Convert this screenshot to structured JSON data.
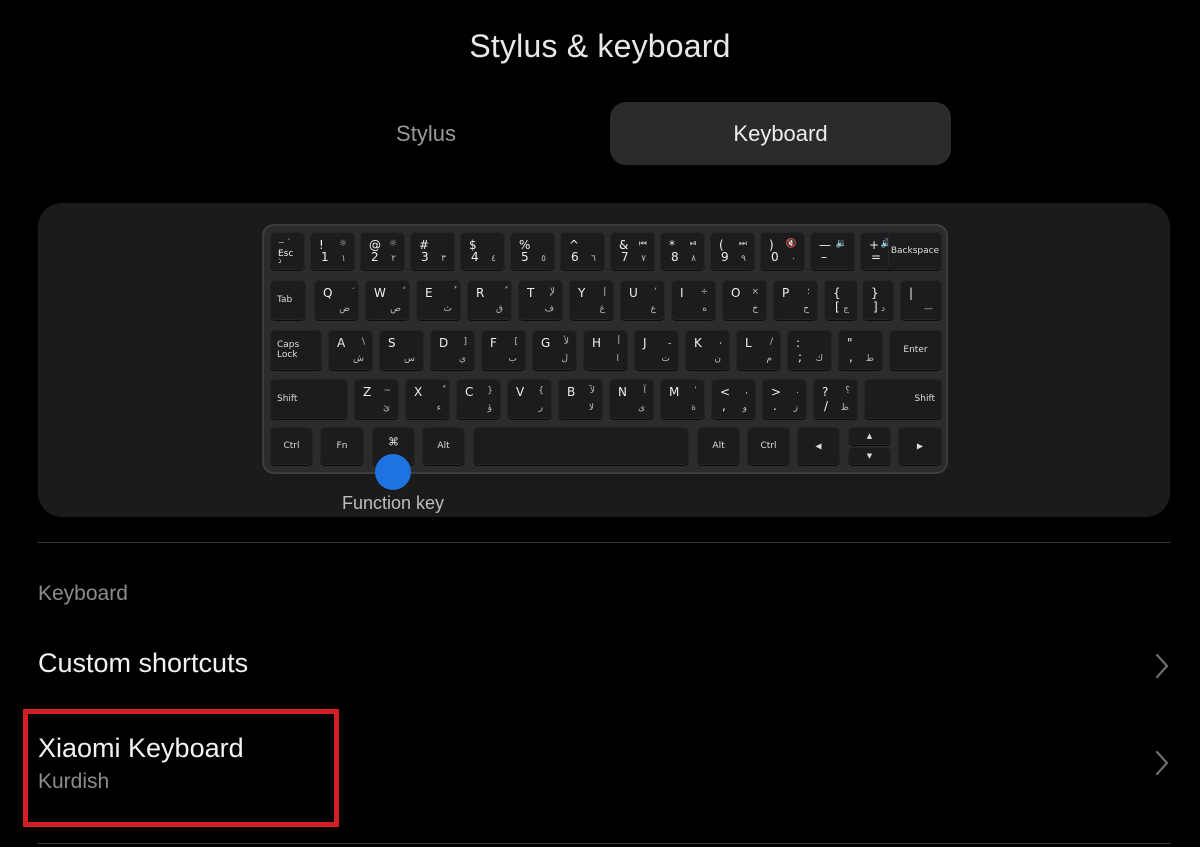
{
  "header": {
    "title": "Stylus & keyboard"
  },
  "tabs": [
    {
      "label": "Stylus",
      "selected": false
    },
    {
      "label": "Keyboard",
      "selected": true
    }
  ],
  "keyboard_diagram": {
    "function_key_label": "Function key",
    "marker_color": "#1f73e0",
    "keys": {
      "esc": {
        "top": "~ `",
        "main": "Esc",
        "bottom": "ذ"
      },
      "k1": {
        "pl": "!",
        "pr": "☼",
        "sl": "1",
        "sr": "١"
      },
      "k2": {
        "pl": "@",
        "pr": "☼",
        "sl": "2",
        "sr": "٢"
      },
      "k3": {
        "pl": "#",
        "sl": "3",
        "sr": "٣"
      },
      "k4": {
        "pl": "$",
        "sl": "4",
        "sr": "٤"
      },
      "k5": {
        "pl": "%",
        "sl": "5",
        "sr": "٥"
      },
      "k6": {
        "pl": "^",
        "sl": "6",
        "sr": "٦"
      },
      "k7": {
        "pl": "&",
        "pr": "⏮",
        "sl": "7",
        "sr": "٧"
      },
      "k8": {
        "pl": "*",
        "pr": "⏯",
        "sl": "8",
        "sr": "٨"
      },
      "k9": {
        "pl": "(",
        "pr": "⏭",
        "sl": "9",
        "sr": "٩"
      },
      "k0": {
        "pl": ")",
        "pr": "🔇",
        "sl": "0",
        "sr": "٠"
      },
      "kminus": {
        "pl": "—",
        "pr": "🔉",
        "sl": "–",
        "sr": ""
      },
      "kplus": {
        "pl": "+",
        "pr": "🔊",
        "sl": "=",
        "sr": ""
      },
      "backspace": "Backspace",
      "tab": "Tab",
      "q": {
        "pl": "Q",
        "pr": "َ",
        "sr": "ض"
      },
      "w": {
        "pl": "W",
        "pr": "ً",
        "sr": "ص"
      },
      "e": {
        "pl": "E",
        "pr": "ُ",
        "sr": "ث"
      },
      "r": {
        "pl": "R",
        "pr": "ٌ",
        "sr": "ق"
      },
      "t": {
        "pl": "T",
        "pr": "لإ",
        "sr": "ف"
      },
      "y": {
        "pl": "Y",
        "pr": "إ",
        "sr": "غ"
      },
      "u": {
        "pl": "U",
        "pr": "‘",
        "sr": "ع"
      },
      "i": {
        "pl": "I",
        "pr": "÷",
        "sr": "ه"
      },
      "o": {
        "pl": "O",
        "pr": "×",
        "sr": "خ"
      },
      "p": {
        "pl": "P",
        "pr": "؛",
        "sr": "ح"
      },
      "lbr": {
        "pl": "{",
        "pr": "<",
        "sl": "[",
        "sr": "ج"
      },
      "rbr": {
        "pl": "}",
        "pr": ">",
        "sl": "]",
        "sr": "د"
      },
      "bsl": {
        "pl": "|",
        "sr": "—"
      },
      "caps": "Caps Lock",
      "a": {
        "pl": "A",
        "pr": "\\",
        "sr": "ش"
      },
      "s": {
        "pl": "S",
        "sr": "س"
      },
      "d": {
        "pl": "D",
        "pr": "]",
        "sr": "ي"
      },
      "f": {
        "pl": "F",
        "pr": "[",
        "sr": "ب"
      },
      "g": {
        "pl": "G",
        "pr": "لأ",
        "sr": "ل"
      },
      "h": {
        "pl": "H",
        "pr": "أ",
        "sr": "ا"
      },
      "j": {
        "pl": "J",
        "pr": "ـ",
        "sr": "ت"
      },
      "k": {
        "pl": "K",
        "pr": "،",
        "sr": "ن"
      },
      "l": {
        "pl": "L",
        "pr": "/",
        "sr": "م"
      },
      "semi": {
        "pl": ":",
        "sl": ";",
        "sr": "ك"
      },
      "quote": {
        "pl": "\"",
        "sl": ",",
        "sr": "ط"
      },
      "enter": "Enter",
      "shift_l": "Shift",
      "z": {
        "pl": "Z",
        "pr": "~",
        "sr": "ئ"
      },
      "x": {
        "pl": "X",
        "pr": "ْ",
        "sr": "ء"
      },
      "c": {
        "pl": "C",
        "pr": "}",
        "sr": "ؤ"
      },
      "v": {
        "pl": "V",
        "pr": "{",
        "sr": "ر"
      },
      "b": {
        "pl": "B",
        "pr": "لآ",
        "sr": "لا"
      },
      "n": {
        "pl": "N",
        "pr": "آ",
        "sr": "ى"
      },
      "m": {
        "pl": "M",
        "pr": "’",
        "sr": "ة"
      },
      "comma": {
        "pl": "<",
        "pr": ",",
        "sl": ",",
        "sr": "و"
      },
      "period": {
        "pl": ">",
        "pr": ".",
        "sl": ".",
        "sr": "ز"
      },
      "slash": {
        "pl": "?",
        "pr": "؟",
        "sl": "/",
        "sr": "ظ"
      },
      "shift_r": "Shift",
      "ctrl_l": "Ctrl",
      "fn": "Fn",
      "func_icon": "⌘",
      "alt_l": "Alt",
      "alt_r": "Alt",
      "ctrl_r": "Ctrl",
      "left": "◀",
      "up": "▲",
      "down": "▼",
      "right": "▶"
    }
  },
  "settings": {
    "section_label": "Keyboard",
    "rows": [
      {
        "title": "Custom shortcuts"
      },
      {
        "title": "Xiaomi Keyboard",
        "subtitle": "Kurdish",
        "highlighted": true
      }
    ]
  },
  "colors": {
    "background": "#000000",
    "tab_selected_bg": "#2b2b2b",
    "panel_bg": "#1b1b1b",
    "highlight_box": "#d32027"
  }
}
